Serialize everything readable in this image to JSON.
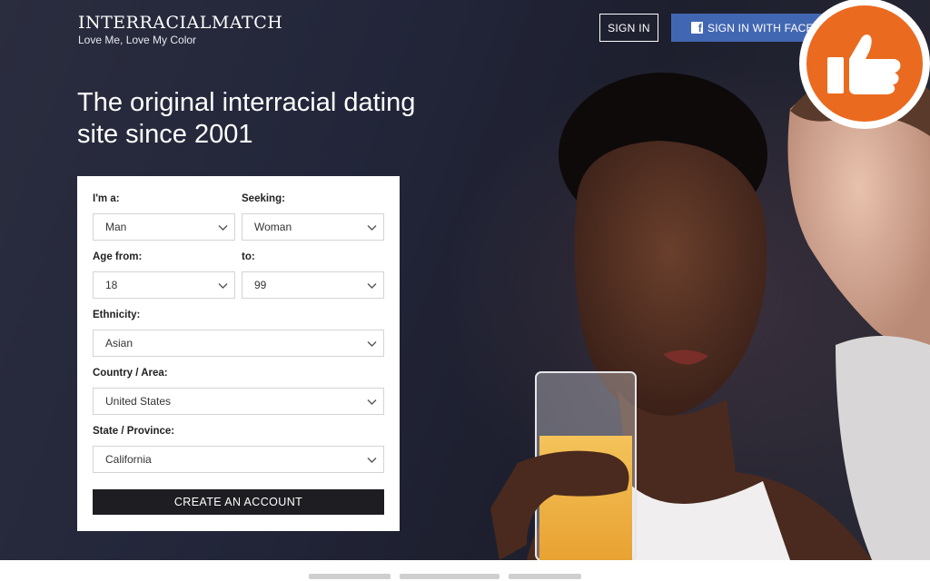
{
  "brand": {
    "name": "INTERRACIALMATCH",
    "tagline": "Love Me, Love My Color"
  },
  "header": {
    "sign_in_label": "SIGN IN",
    "facebook_label": "SIGN IN WITH FACEBOOK",
    "facebook_color": "#4267b2"
  },
  "badge": {
    "icon": "thumbs-up-icon",
    "color": "#ea6a1f"
  },
  "hero": {
    "headline_line1": "The original interracial dating",
    "headline_line2": "site since 2001"
  },
  "form": {
    "gender": {
      "label": "I'm a:",
      "value": "Man"
    },
    "seeking": {
      "label": "Seeking:",
      "value": "Woman"
    },
    "age_from": {
      "label": "Age from:",
      "value": "18"
    },
    "age_to": {
      "label": "to:",
      "value": "99"
    },
    "ethnicity": {
      "label": "Ethnicity:",
      "value": "Asian"
    },
    "country": {
      "label": "Country / Area:",
      "value": "United States"
    },
    "state": {
      "label": "State / Province:",
      "value": "California"
    },
    "submit_label": "CREATE AN ACCOUNT"
  }
}
